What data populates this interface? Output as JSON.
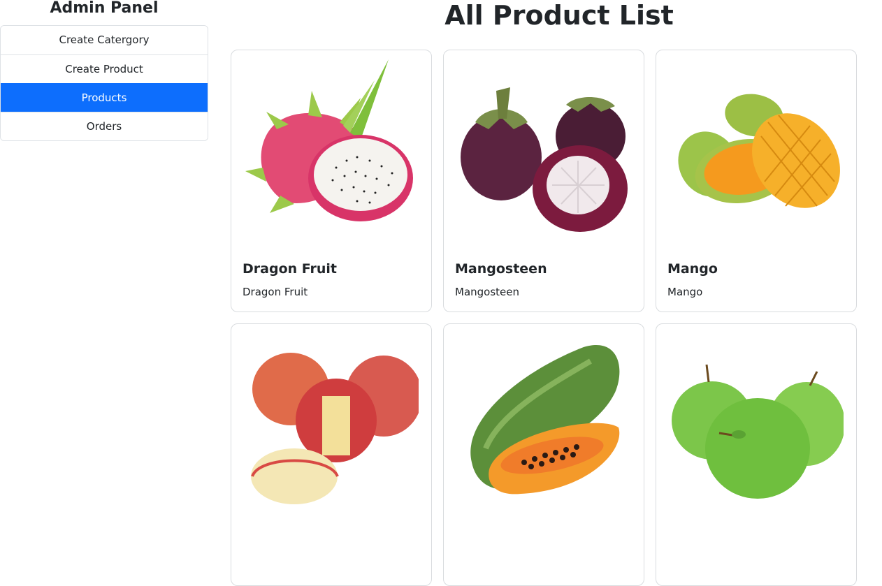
{
  "sidebar": {
    "title": "Admin Panel",
    "items": [
      {
        "label": "Create Catergory",
        "active": false
      },
      {
        "label": "Create Product",
        "active": false
      },
      {
        "label": "Products",
        "active": true
      },
      {
        "label": "Orders",
        "active": false
      }
    ]
  },
  "main": {
    "title": "All Product List",
    "products": [
      {
        "name": "Dragon Fruit",
        "description": "Dragon Fruit",
        "image": "dragon-fruit"
      },
      {
        "name": "Mangosteen",
        "description": "Mangosteen",
        "image": "mangosteen"
      },
      {
        "name": "Mango",
        "description": "Mango",
        "image": "mango"
      },
      {
        "name": "",
        "description": "",
        "image": "apple-red"
      },
      {
        "name": "",
        "description": "",
        "image": "papaya"
      },
      {
        "name": "",
        "description": "",
        "image": "apple-green"
      }
    ]
  },
  "colors": {
    "active": "#0d6efd",
    "border": "#dee2e6"
  }
}
